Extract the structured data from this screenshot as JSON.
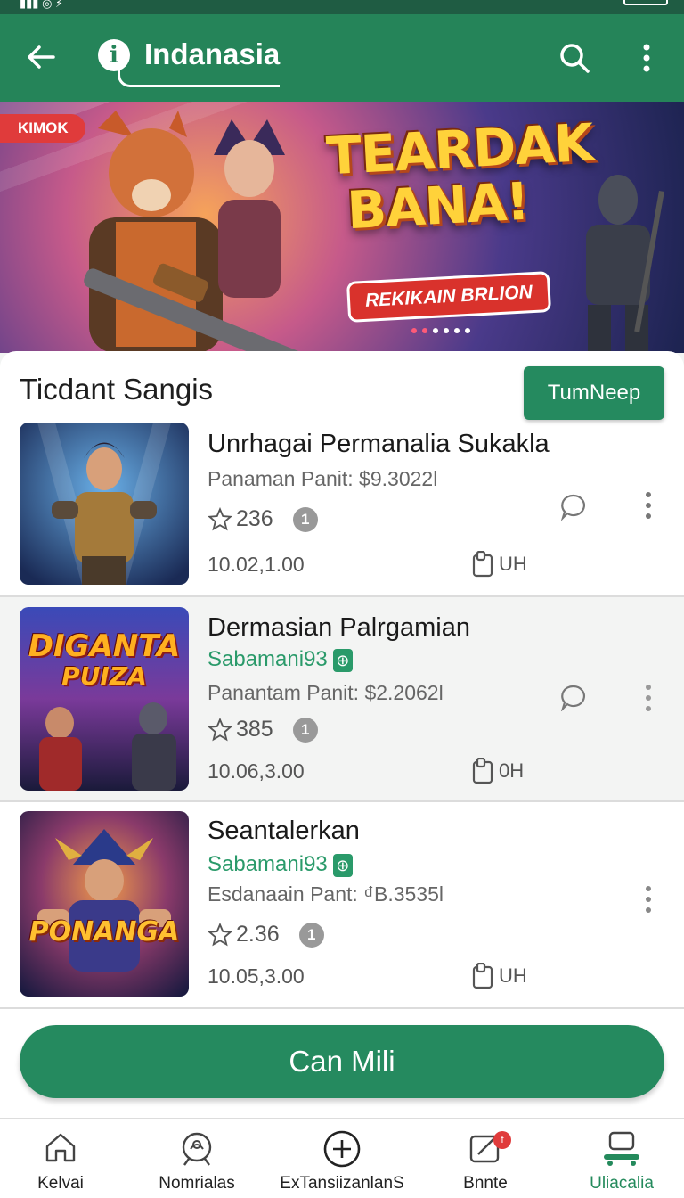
{
  "app_bar": {
    "title": "Indanasia",
    "back_icon": "arrow-left-icon",
    "info_icon": "info-icon",
    "search_icon": "search-icon",
    "more_icon": "more-vertical-icon"
  },
  "banner": {
    "badge": "KIMOK",
    "headline_line1": "TEARDAK",
    "headline_line2": "BANA!",
    "button": "REKIKAIN BRLION",
    "dots_total": 6,
    "dots_active": 1
  },
  "section": {
    "title": "Ticdant Sangis",
    "action_label": "TumNeep"
  },
  "items": [
    {
      "name": "Unrhagai Permanalia Sukakla",
      "developer": "",
      "meta": "Panaman Panit: $9.3022l",
      "rating": "236",
      "badge": "1",
      "date": "10.02,1.00",
      "size": "UH",
      "has_chat": true
    },
    {
      "name": "Dermasian Palrgamian",
      "developer": "Sabamani93",
      "meta": "Panantam Panit: $2.2062l",
      "rating": "385",
      "badge": "1",
      "date": "10.06,3.00",
      "size": "0H",
      "has_chat": true,
      "thumb_text_1": "DIGANTA",
      "thumb_text_2": "PUIZA"
    },
    {
      "name": "Seantalerkan",
      "developer": "Sabamani93",
      "meta": "Esdanaain Pant: ₫B.3535l",
      "rating": "2.36",
      "badge": "1",
      "date": "10.05,3.00",
      "size": "UH",
      "has_chat": false,
      "thumb_text_1": "PONANGA"
    }
  ],
  "cta": {
    "label": "Can Mili"
  },
  "bottom_nav": [
    {
      "label": "Kelvai",
      "icon": "home-icon",
      "active": false
    },
    {
      "label": "Nomrialas",
      "icon": "search-user-icon",
      "active": false
    },
    {
      "label": "ExTansiizanlanS",
      "icon": "plus-circle-icon",
      "active": false
    },
    {
      "label": "Bnnte",
      "icon": "edit-icon",
      "active": false,
      "badge": "f"
    },
    {
      "label": "Uliacalia",
      "icon": "profile-icon",
      "active": true
    }
  ],
  "colors": {
    "primary": "#258459",
    "accent_text": "#2a9a6a",
    "badge_red": "#e03b3b"
  }
}
